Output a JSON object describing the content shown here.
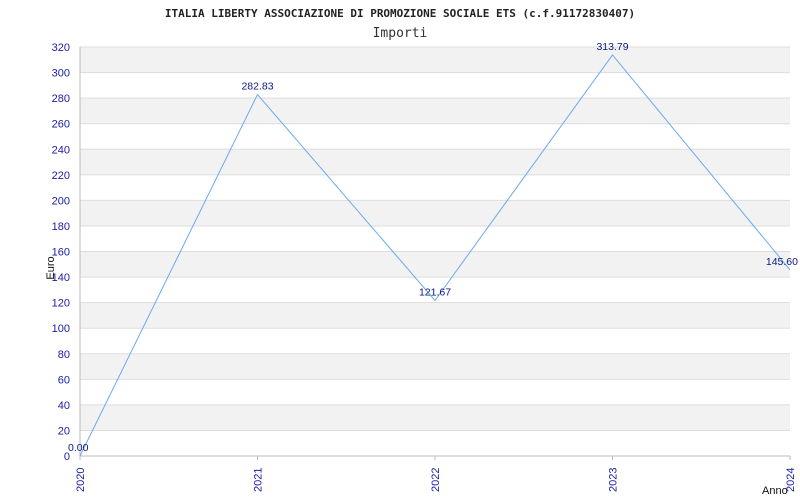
{
  "chart_data": {
    "type": "line",
    "title": "ITALIA LIBERTY ASSOCIAZIONE DI PROMOZIONE SOCIALE ETS (c.f.91172830407)",
    "subtitle": "Importi",
    "xlabel": "Anno",
    "ylabel": "Euro",
    "categories": [
      "2020",
      "2021",
      "2022",
      "2023",
      "2024"
    ],
    "series": [
      {
        "values": [
          0.0,
          282.83,
          121.67,
          313.79,
          145.6
        ],
        "labels": [
          "0.00",
          "282.83",
          "121.67",
          "313.79",
          "145.60"
        ]
      }
    ],
    "ylim": [
      0,
      320
    ],
    "yticks": [
      "0",
      "20",
      "40",
      "60",
      "80",
      "100",
      "120",
      "140",
      "160",
      "180",
      "200",
      "220",
      "240",
      "260",
      "280",
      "300",
      "320"
    ],
    "grid": true,
    "colors": {
      "line": "#6aaaf0",
      "band": "#f2f2f2",
      "gridline": "#dddddd",
      "tick": "#1a1aa6"
    }
  }
}
